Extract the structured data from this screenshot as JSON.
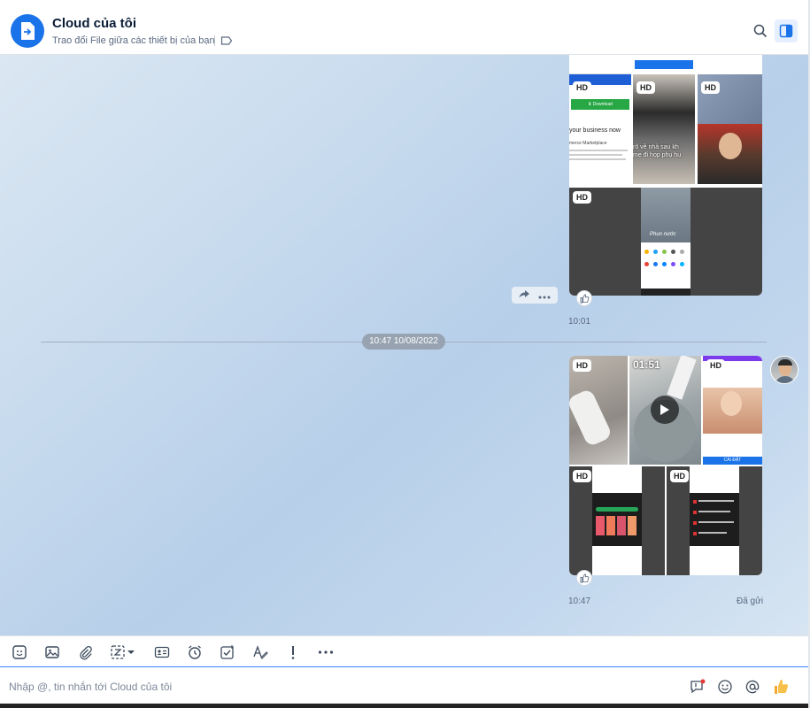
{
  "header": {
    "title": "Cloud của tôi",
    "subtitle": "Trao đổi File giữa các thiết bị của bạn"
  },
  "messages": {
    "first": {
      "hd_badges": [
        "HD",
        "HD",
        "HD",
        "HD"
      ],
      "preview_texts": {
        "download": "⬇ Download",
        "headline": "your business now",
        "marketplace": "merce Marketplace",
        "caption": "rõ về nhà sau kh\nmẹ đi họp phụ hu",
        "phone_text": "Phun nước"
      },
      "time": "10:01"
    },
    "date_divider": "10:47 10/08/2022",
    "second": {
      "hd_badges": [
        "HD",
        "HD",
        "HD",
        "HD"
      ],
      "video_duration": "01:51",
      "install_label": "CÀI ĐẶT",
      "time": "10:47",
      "status": "Đã gửi"
    }
  },
  "composer": {
    "placeholder": "Nhập @, tin nhắn tới Cloud của tôi"
  },
  "colors": {
    "accent": "#1a73e8",
    "pill": "#97a3b1"
  }
}
